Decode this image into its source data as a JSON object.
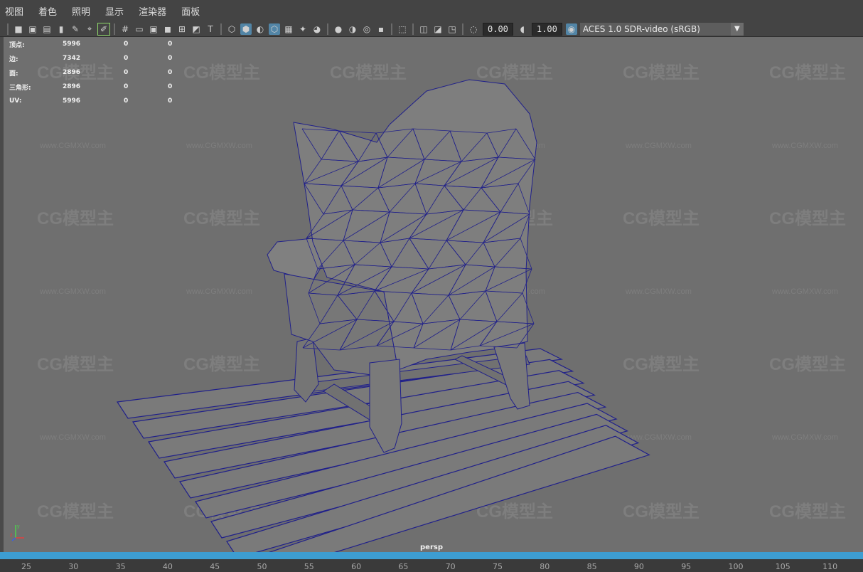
{
  "menu": [
    "视图",
    "着色",
    "照明",
    "显示",
    "渲染器",
    "面板"
  ],
  "toolbar": {
    "exposure": "0.00",
    "gamma": "1.00",
    "color_space": "ACES 1.0 SDR-video (sRGB)"
  },
  "hud": [
    {
      "label": "顶点:",
      "v1": "5996",
      "v2": "0",
      "v3": "0"
    },
    {
      "label": "边:",
      "v1": "7342",
      "v2": "0",
      "v3": "0"
    },
    {
      "label": "面:",
      "v1": "2896",
      "v2": "0",
      "v3": "0"
    },
    {
      "label": "三角形:",
      "v1": "2896",
      "v2": "0",
      "v3": "0"
    },
    {
      "label": "UV:",
      "v1": "5996",
      "v2": "0",
      "v3": "0"
    }
  ],
  "camera_label": "persp",
  "timeline_ticks": [
    "25",
    "30",
    "35",
    "40",
    "45",
    "50",
    "55",
    "60",
    "65",
    "70",
    "75",
    "80",
    "85",
    "90",
    "95",
    "100",
    "105",
    "110"
  ],
  "watermark": {
    "logo": "CG模型主",
    "url": "www.CGMXW.com"
  },
  "colors": {
    "wire": "#20208a",
    "viewport_bg": "#6f6f6f",
    "accent": "#3d9dd1"
  }
}
